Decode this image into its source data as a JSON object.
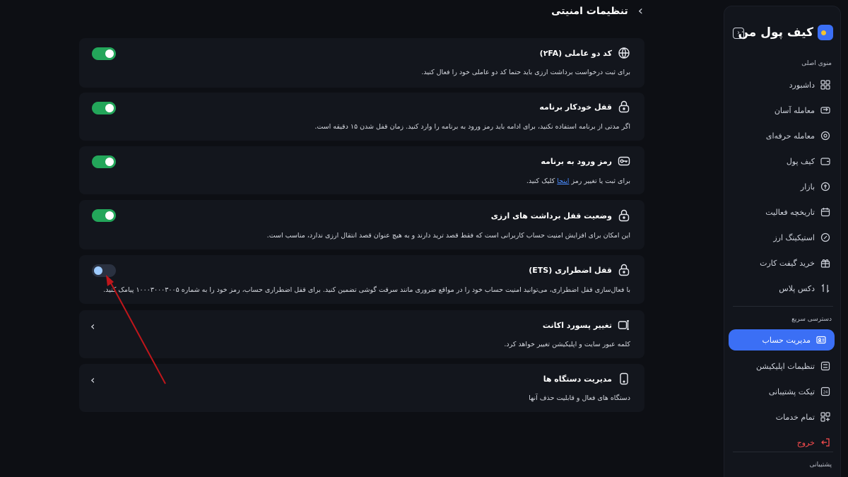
{
  "brand": {
    "name": "کیف پول من"
  },
  "sidebar": {
    "main_label": "منوی اصلی",
    "items": [
      {
        "label": "داشبورد",
        "icon": "grid-icon"
      },
      {
        "label": "معامله آسان",
        "icon": "exchange-icon"
      },
      {
        "label": "معامله حرفه‌ای",
        "icon": "trade-icon"
      },
      {
        "label": "کیف پول",
        "icon": "wallet-icon"
      },
      {
        "label": "بازار",
        "icon": "market-icon"
      },
      {
        "label": "تاریخچه فعالیت",
        "icon": "calendar-icon"
      },
      {
        "label": "استیکینگ ارز",
        "icon": "staking-icon"
      },
      {
        "label": "خرید گیفت کارت",
        "icon": "gift-icon"
      },
      {
        "label": "دکس پلاس",
        "icon": "dex-icon"
      }
    ],
    "quick_label": "دسترسی سریع",
    "quick_items": [
      {
        "label": "مدیریت حساب",
        "icon": "id-card-icon",
        "active": true
      },
      {
        "label": "تنظیمات اپلیکیشن",
        "icon": "settings-icon"
      },
      {
        "label": "تیکت پشتیبانی",
        "icon": "support-24-icon"
      },
      {
        "label": "تمام خدمات",
        "icon": "apps-icon"
      }
    ],
    "logout_label": "خروج",
    "support_label": "پشتیبانی"
  },
  "page": {
    "title": "تنظیمات امنیتی"
  },
  "cards": [
    {
      "title": "کد دو عاملی (۲FA)",
      "desc": "برای ثبت درخواست برداشت ارزی باید حتما کد دو عاملی خود را فعال کنید.",
      "icon": "2fa-icon",
      "toggle": "on"
    },
    {
      "title": "قفل خودکار برنامه",
      "desc": "اگر مدتی از برنامه استفاده نکنید، برای ادامه باید رمز ورود به برنامه را وارد کنید. زمان قفل شدن ۱۵ دقیقه است.",
      "icon": "lock-icon",
      "toggle": "on"
    },
    {
      "title": "رمز ورود به برنامه",
      "desc_pre": "برای ثبت یا تغییر رمز ",
      "desc_link": "اینجا",
      "desc_post": " کلیک کنید.",
      "icon": "key-icon",
      "toggle": "on"
    },
    {
      "title": "وضعیت قفل برداشت های ارزی",
      "desc": "این امکان برای افزایش امنیت حساب کاربرانی است که فقط قصد ترید دارند و به هیچ عنوان قصد انتقال ارزی ندارد، مناسب است.",
      "icon": "lock-icon",
      "toggle": "on"
    },
    {
      "title": "قفل اضطراری (ETS)",
      "desc": "با فعال‌سازی قفل اضطراری، می‌توانید امنیت حساب خود را در مواقع ضروری مانند سرقت گوشی تضمین کنید. برای قفل اضطراری حساب، رمز خود را به شماره ۱۰۰۰۳۰۰۰۳۰۰۵ پیامک کنید.",
      "icon": "lock-icon",
      "toggle": "off"
    },
    {
      "title": "تغییر پسورد اکانت",
      "desc": "کلمه عبور سایت و اپلیکیشن تغییر خواهد کرد.",
      "icon": "password-icon",
      "toggle": "none"
    },
    {
      "title": "مدیریت دستگاه ها",
      "desc": "دستگاه های فعال و قابلیت حذف آنها",
      "icon": "device-icon",
      "toggle": "none"
    }
  ],
  "colors": {
    "accent": "#3b6ff5",
    "toggle_on": "#23a65a",
    "logout": "#ff4d4f",
    "arrow": "#c0161b"
  }
}
